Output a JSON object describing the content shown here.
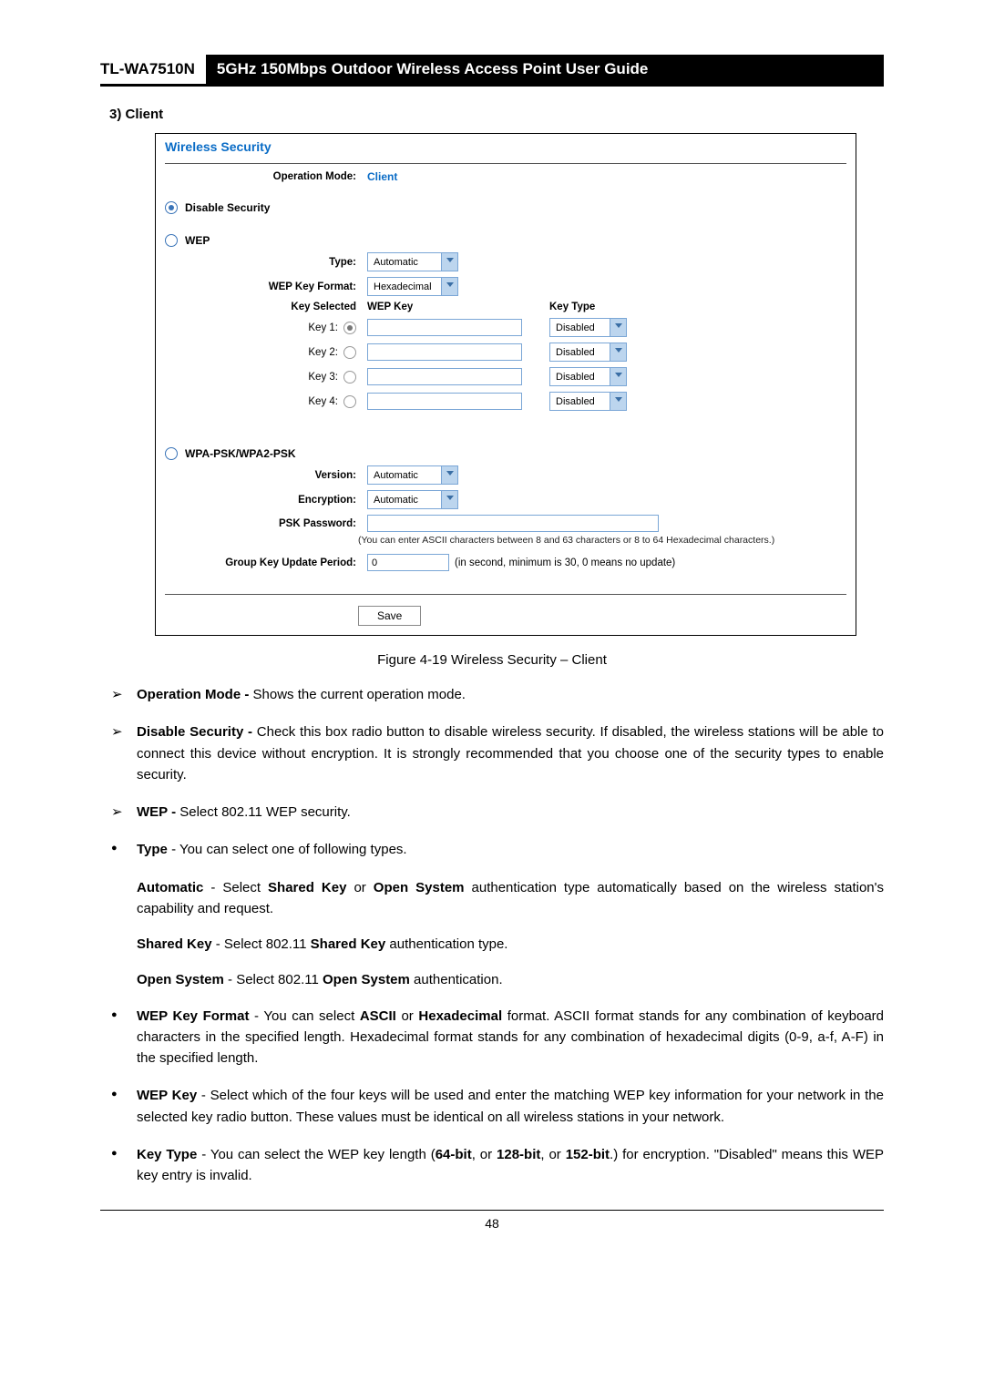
{
  "header": {
    "model": "TL-WA7510N",
    "title": "5GHz 150Mbps Outdoor Wireless Access Point User Guide"
  },
  "section_heading": "3)   Client",
  "figure": {
    "panel_title": "Wireless Security",
    "op_mode_label": "Operation Mode:",
    "op_mode_value": "Client",
    "disable_sec_label": "Disable Security",
    "wep": {
      "title": "WEP",
      "type_label": "Type:",
      "type_value": "Automatic",
      "format_label": "WEP Key Format:",
      "format_value": "Hexadecimal",
      "col_key_selected": "Key Selected",
      "col_wep_key": "WEP Key",
      "col_key_type": "Key Type",
      "rows": [
        {
          "label": "Key 1:",
          "selected": true,
          "keytype": "Disabled"
        },
        {
          "label": "Key 2:",
          "selected": false,
          "keytype": "Disabled"
        },
        {
          "label": "Key 3:",
          "selected": false,
          "keytype": "Disabled"
        },
        {
          "label": "Key 4:",
          "selected": false,
          "keytype": "Disabled"
        }
      ]
    },
    "wpa": {
      "title": "WPA-PSK/WPA2-PSK",
      "version_label": "Version:",
      "version_value": "Automatic",
      "encryption_label": "Encryption:",
      "encryption_value": "Automatic",
      "psk_label": "PSK Password:",
      "psk_note": "(You can enter ASCII characters between 8 and 63 characters or 8 to 64 Hexadecimal characters.)",
      "gkup_label": "Group Key Update Period:",
      "gkup_value": "0",
      "gkup_note": "(in second, minimum is 30, 0 means no update)"
    },
    "save_label": "Save"
  },
  "figure_caption": "Figure 4-19 Wireless Security – Client",
  "bullets": {
    "op_mode_term": "Operation Mode - ",
    "op_mode_desc": "Shows the current operation mode.",
    "disable_term": "Disable Security - ",
    "disable_desc": "Check this box radio button to disable wireless security. If disabled, the wireless stations will be able to connect this device without encryption. It is strongly recommended that you choose one of the security types to enable security.",
    "wep_term": "WEP - ",
    "wep_desc": "Select 802.11 WEP security.",
    "type_term": "Type",
    "type_desc": " - You can select one of following types.",
    "auto_term": "Automatic",
    "auto_desc_1": " - Select ",
    "auto_desc_sk": "Shared Key",
    "auto_desc_2": " or ",
    "auto_desc_os": "Open System",
    "auto_desc_3": " authentication type automatically based on the wireless station's capability and request.",
    "sk_term": "Shared Key",
    "sk_desc_1": " - Select 802.11 ",
    "sk_desc_2": " authentication type.",
    "os_term": "Open System",
    "os_desc_1": " - Select 802.11 ",
    "os_desc_2": " authentication.",
    "wkf_term": "WEP Key Format",
    "wkf_desc_1": " - You can select ",
    "wkf_ascii": "ASCII",
    "wkf_desc_2": " or ",
    "wkf_hex": "Hexadecimal",
    "wkf_desc_3": " format. ASCII format stands for any combination of keyboard characters in the specified length. Hexadecimal format stands for any combination of hexadecimal digits (0-9, a-f, A-F) in the specified length.",
    "wk_term": "WEP Key",
    "wk_desc": " - Select which of the four keys will be used and enter the matching WEP key information for your network in the selected key radio button. These values must be identical on all wireless stations in your network.",
    "kt_term": "Key Type",
    "kt_desc_1": " - You can select the WEP key length (",
    "kt_64": "64-bit",
    "kt_desc_2": ", or ",
    "kt_128": "128-bit",
    "kt_desc_3": ", or ",
    "kt_152": "152-bit",
    "kt_desc_4": ".) for encryption. \"Disabled\" means this WEP key entry is invalid."
  },
  "page_number": "48"
}
